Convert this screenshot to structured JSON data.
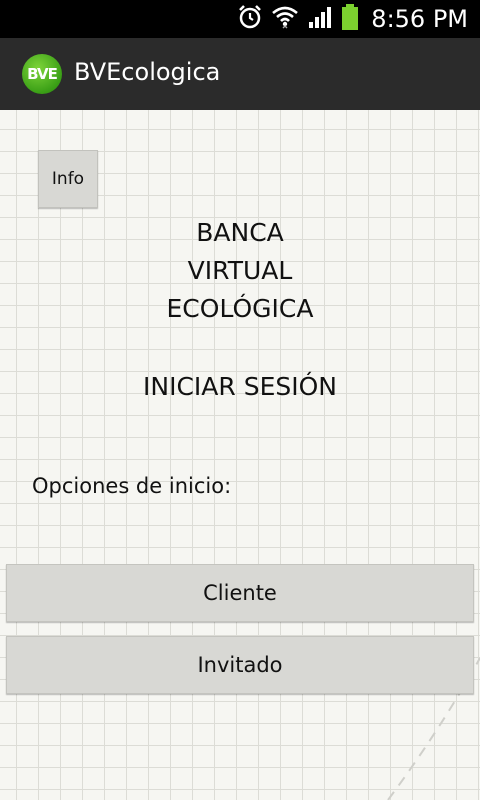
{
  "status_bar": {
    "time": "8:56 PM",
    "icons": [
      "alarm-icon",
      "wifi-icon",
      "signal-icon",
      "battery-icon"
    ]
  },
  "action_bar": {
    "logo_text": "BVE",
    "title": "BVEcologica"
  },
  "main": {
    "info_button": "Info",
    "bank_title_lines": [
      "BANCA",
      "VIRTUAL",
      "ECOLÓGICA"
    ],
    "section_title": "INICIAR SESIÓN",
    "options_label": "Opciones de inicio:",
    "buttons": {
      "cliente": "Cliente",
      "invitado": "Invitado"
    }
  },
  "colors": {
    "status_bar": "#000000",
    "action_bar": "#2b2b2b",
    "background": "#f6f6f2",
    "button": "#d8d8d4",
    "logo_green": "#3a9f16"
  }
}
